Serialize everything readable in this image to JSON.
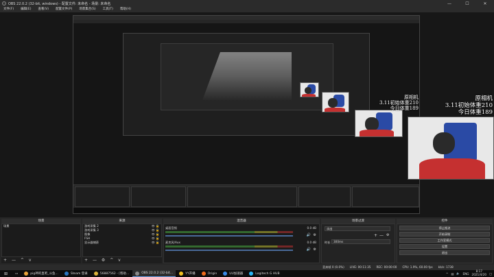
{
  "window": {
    "title": "OBS 22.0.2 (32-bit, windows) - 配置文件: 未命名 - 场景: 未命名",
    "controls": [
      "—",
      "☐",
      "✕"
    ]
  },
  "menu": [
    "文件(F)",
    "编辑(E)",
    "查看(V)",
    "配置文件(P)",
    "场景集合(S)",
    "工具(T)",
    "帮助(H)"
  ],
  "overlay": {
    "line1": "原相机",
    "line2": "3.11初始体重210",
    "line3": "今日体重189"
  },
  "docks": {
    "scenes": {
      "title": "场景",
      "items": [
        "场景"
      ],
      "footer": [
        "+",
        "—",
        "^",
        "v"
      ]
    },
    "sources": {
      "title": "来源",
      "items": [
        "游戏采集 2",
        "游戏采集 3",
        "图像",
        "FSH",
        "显示器捕获"
      ],
      "footer": [
        "+",
        "—",
        "⚙",
        "^",
        "v"
      ]
    },
    "mixer": {
      "title": "混音器",
      "channels": [
        {
          "name": "桌面音频",
          "db": "0.0 dB"
        },
        {
          "name": "麦克风/Aux",
          "db": "0.0 dB"
        }
      ]
    },
    "transitions": {
      "title": "场景过渡",
      "type": "淡出",
      "duration_label": "时长",
      "duration": "300ms"
    },
    "controls": {
      "title": "控件",
      "buttons": [
        "停止推流",
        "开始录制",
        "工作室模式",
        "设置",
        "退出"
      ]
    }
  },
  "status": {
    "dropped": "丢弃帧 0 (0.0%)",
    "live": "LIVE: 00:11:35",
    "rec": "REC: 00:00:00",
    "cpu": "CPU: 1.9%, 60.00 fps",
    "bitrate": "kb/s: 1738"
  },
  "taskbar": {
    "items": [
      {
        "label": "pig神的直吧_斗鱼...",
        "color": "#e8a33a"
      },
      {
        "label": "Steam 登录",
        "color": "#2a75c0"
      },
      {
        "label": "56887562 - [帮助...",
        "color": "#d9b13a"
      },
      {
        "label": "OBS 22.0.2 (32-bit...",
        "color": "#888888"
      },
      {
        "label": "YY开播",
        "color": "#f0c020"
      },
      {
        "label": "Origin",
        "color": "#f06a1a"
      },
      {
        "label": "UU加速器",
        "color": "#3a8ae8"
      },
      {
        "label": "Logitech G HUB",
        "color": "#29b6f6"
      }
    ],
    "tray_lang": "ENG",
    "time": "8:17",
    "date": "2021/4/20"
  }
}
